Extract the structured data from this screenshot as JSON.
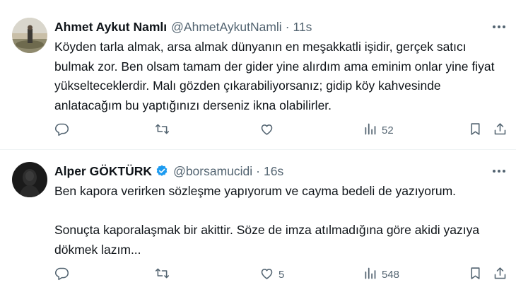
{
  "tweets": [
    {
      "name": "Ahmet Aykut Namlı",
      "handle": "@AhmetAykutNamli",
      "separator": "·",
      "time": "11s",
      "verified": false,
      "text": "Köyden tarla almak, arsa almak dünyanın en meşakkatli işidir, gerçek satıcı bulmak zor. Ben olsam tamam der gider yine alırdım ama eminim onlar yine fiyat yükselteceklerdir. Malı gözden çıkarabiliyorsanız; gidip köy kahvesinde anlatacağım bu yaptığınızı derseniz ikna olabilirler.",
      "likes": "",
      "views": "52"
    },
    {
      "name": "Alper GÖKTÜRK",
      "handle": "@borsamucidi",
      "separator": "·",
      "time": "16s",
      "verified": true,
      "text": "Ben kapora verirken sözleşme yapıyorum ve cayma bedeli de yazıyorum.\n\nSonuçta kaporalaşmak bir akittir. Söze de imza atılmadığına göre akidi yazıya dökmek lazım...",
      "likes": "5",
      "views": "548"
    }
  ],
  "colors": {
    "text": "#0f1419",
    "secondary": "#536471",
    "verified": "#1d9bf0",
    "divider": "#eff3f4"
  },
  "icons": [
    "reply-icon",
    "retweet-icon",
    "like-icon",
    "views-icon",
    "bookmark-icon",
    "share-icon",
    "more-icon",
    "verified-badge-icon"
  ]
}
